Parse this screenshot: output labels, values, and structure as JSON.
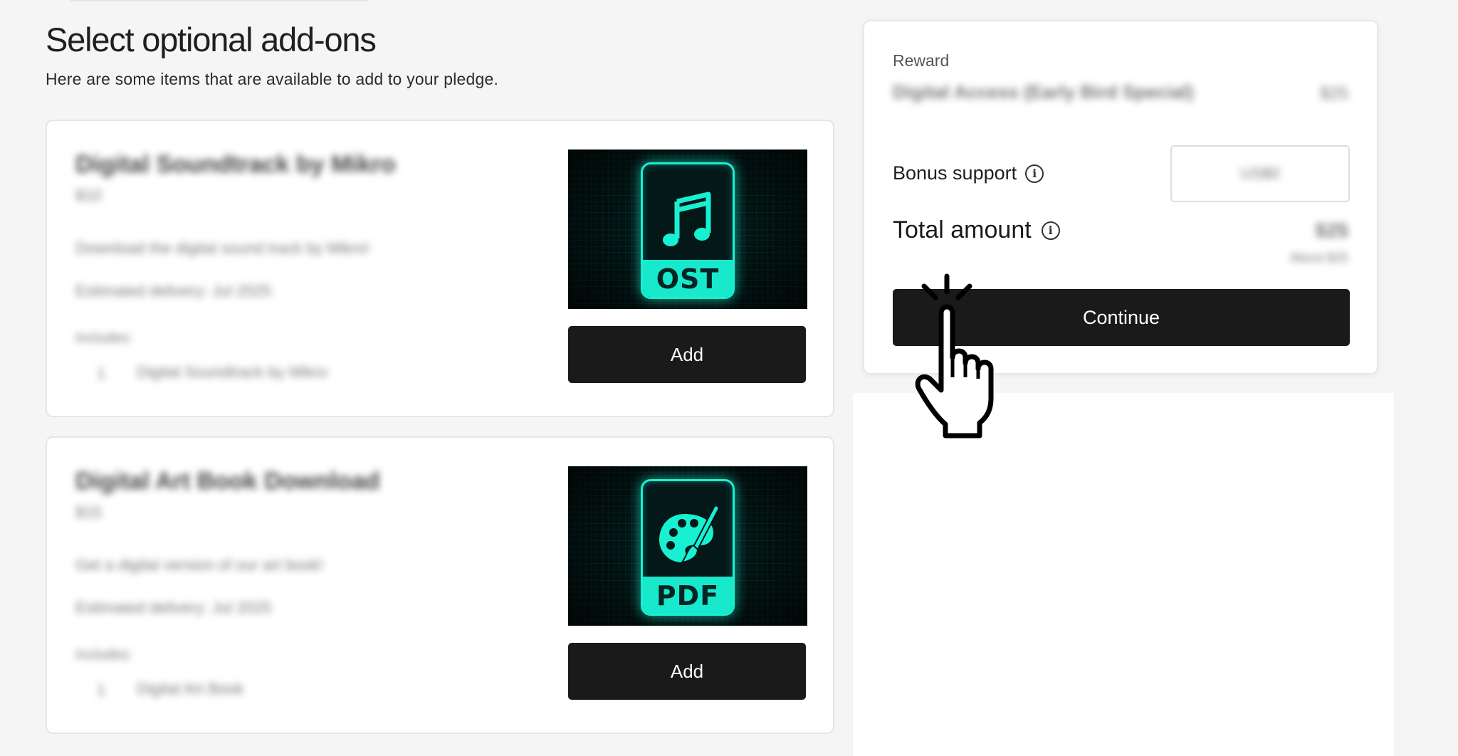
{
  "header": {
    "title": "Select optional add-ons",
    "subtitle": "Here are some items that are available to add to your pledge."
  },
  "addons": [
    {
      "title": "Digital Soundtrack by Mikro",
      "price": "$10",
      "description": "Download the digital sound track by Mikro!",
      "delivery": "Estimated delivery: Jul 2025",
      "includes_label": "Includes:",
      "include_bullet": "1",
      "include_item": "Digital Soundtrack by Mikro",
      "image_label": "OST",
      "image_icon": "music-note-icon",
      "add_label": "Add"
    },
    {
      "title": "Digital Art Book Download",
      "price": "$15",
      "description": "Get a digital version of our art book!",
      "delivery": "Estimated delivery: Jul 2025",
      "includes_label": "Includes:",
      "include_bullet": "1",
      "include_item": "Digital Art Book",
      "image_label": "PDF",
      "image_icon": "palette-icon",
      "add_label": "Add"
    }
  ],
  "summary": {
    "reward_label": "Reward",
    "reward_name": "Digital Access (Early Bird Special)",
    "reward_price": "$25",
    "bonus_label": "Bonus support",
    "bonus_value": "US$0",
    "total_label": "Total amount",
    "total_value": "$25",
    "total_note": "About $25",
    "continue_label": "Continue"
  },
  "colors": {
    "accent": "#18f0d2",
    "button": "#1a1a1a",
    "background": "#f5f5f5"
  }
}
